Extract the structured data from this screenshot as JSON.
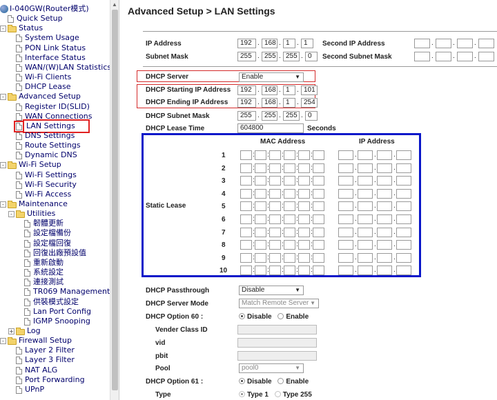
{
  "sidebar": {
    "items": [
      {
        "label": "I-040GW(Router模式)",
        "kind": "root"
      },
      {
        "label": "Quick Setup",
        "kind": "page"
      },
      {
        "label": "Status",
        "kind": "folder"
      },
      {
        "label": "System Usage",
        "kind": "page"
      },
      {
        "label": "PON Link Status",
        "kind": "page"
      },
      {
        "label": "Interface Status",
        "kind": "page"
      },
      {
        "label": "WAN/(W)LAN Statistics",
        "kind": "page"
      },
      {
        "label": "Wi-Fi Clients",
        "kind": "page"
      },
      {
        "label": "DHCP Lease",
        "kind": "page"
      },
      {
        "label": "Advanced Setup",
        "kind": "folder"
      },
      {
        "label": "Register ID(SLID)",
        "kind": "page"
      },
      {
        "label": "WAN Connections",
        "kind": "page"
      },
      {
        "label": "LAN Settings",
        "kind": "page",
        "selected": true
      },
      {
        "label": "DNS Settings",
        "kind": "page"
      },
      {
        "label": "Route Settings",
        "kind": "page"
      },
      {
        "label": "Dynamic DNS",
        "kind": "page"
      },
      {
        "label": "Wi-Fi Setup",
        "kind": "folder"
      },
      {
        "label": "Wi-Fi Settings",
        "kind": "page"
      },
      {
        "label": "Wi-Fi Security",
        "kind": "page"
      },
      {
        "label": "Wi-Fi Access",
        "kind": "page"
      },
      {
        "label": "Maintenance",
        "kind": "folder"
      },
      {
        "label": "Utilities",
        "kind": "folder"
      },
      {
        "label": "韌體更新",
        "kind": "page"
      },
      {
        "label": "設定檔備份",
        "kind": "page"
      },
      {
        "label": "設定檔回復",
        "kind": "page"
      },
      {
        "label": "回復出廠預設值",
        "kind": "page"
      },
      {
        "label": "重新啟動",
        "kind": "page"
      },
      {
        "label": "系統設定",
        "kind": "page"
      },
      {
        "label": "連接測試",
        "kind": "page"
      },
      {
        "label": "TR069 Management",
        "kind": "page"
      },
      {
        "label": "供裝模式設定",
        "kind": "page"
      },
      {
        "label": "Lan Port Config",
        "kind": "page"
      },
      {
        "label": "IGMP Snooping",
        "kind": "page"
      },
      {
        "label": "Log",
        "kind": "folder"
      },
      {
        "label": "Firewall Setup",
        "kind": "folder"
      },
      {
        "label": "Layer 2 Filter",
        "kind": "page"
      },
      {
        "label": "Layer 3 Filter",
        "kind": "page"
      },
      {
        "label": "NAT ALG",
        "kind": "page"
      },
      {
        "label": "Port Forwarding",
        "kind": "page"
      },
      {
        "label": "UPnP",
        "kind": "page"
      }
    ]
  },
  "header": {
    "title": "Advanced Setup > LAN Settings"
  },
  "lan": {
    "ip_label": "IP Address",
    "ip": [
      "192",
      "168",
      "1",
      "1"
    ],
    "second_ip_label": "Second IP Address",
    "mask_label": "Subnet Mask",
    "mask": [
      "255",
      "255",
      "255",
      "0"
    ],
    "second_mask_label": "Second Subnet Mask",
    "dhcp_server_label": "DHCP Server",
    "dhcp_server_value": "Enable",
    "dhcp_start_label": "DHCP Starting IP Address",
    "dhcp_start": [
      "192",
      "168",
      "1",
      "101"
    ],
    "dhcp_end_label": "DHCP Ending IP Address",
    "dhcp_end": [
      "192",
      "168",
      "1",
      "254"
    ],
    "dhcp_mask_label": "DHCP Subnet Mask",
    "dhcp_mask": [
      "255",
      "255",
      "255",
      "0"
    ],
    "lease_label": "DHCP Lease Time",
    "lease_value": "604800",
    "lease_unit": "Seconds"
  },
  "static_lease": {
    "label": "Static Lease",
    "mac_header": "MAC Address",
    "ip_header": "IP Address",
    "rows": [
      "1",
      "2",
      "3",
      "4",
      "5",
      "6",
      "7",
      "8",
      "9",
      "10"
    ]
  },
  "lower": {
    "passthrough_label": "DHCP Passthrough",
    "passthrough_value": "Disable",
    "mode_label": "DHCP Server Mode",
    "mode_value": "Match Remote Server",
    "opt60_label": "DHCP Option 60 :",
    "opt60_disable": "Disable",
    "opt60_enable": "Enable",
    "vender_label": "Vender Class ID",
    "vid_label": "vid",
    "pbit_label": "pbit",
    "pool_label": "Pool",
    "pool_value": "pool0",
    "opt61_label": "DHCP Option 61 :",
    "opt61_disable": "Disable",
    "opt61_enable": "Enable",
    "type_label": "Type",
    "type1": "Type 1",
    "type255": "Type 255"
  }
}
